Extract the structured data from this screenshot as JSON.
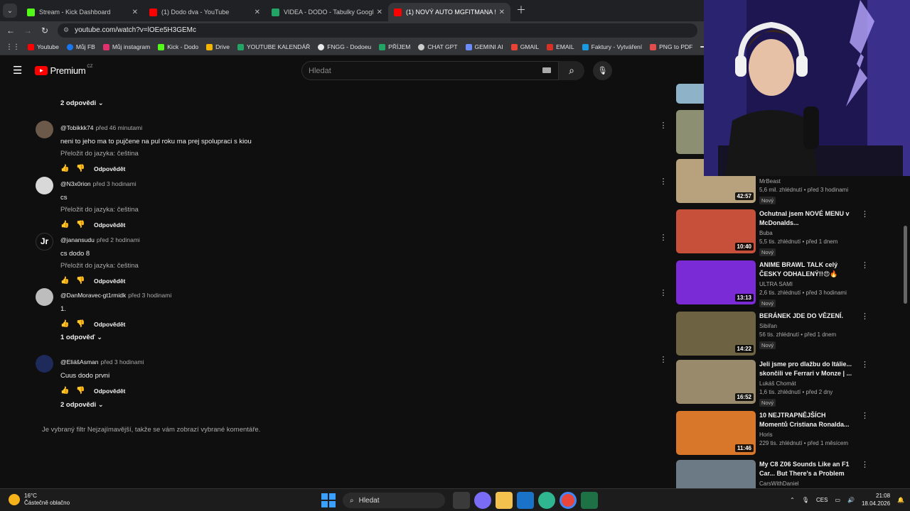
{
  "browser": {
    "tabs": [
      {
        "label": "Stream - Kick Dashboard",
        "color": "#53fc18"
      },
      {
        "label": "(1) Dodo dva - YouTube",
        "color": "#ff0000"
      },
      {
        "label": "VIDEA - DODO - Tabulky Googl",
        "color": "#21a464"
      },
      {
        "label": "(1) NOVÝ AUTO MGFITMANA !!",
        "color": "#ff0000"
      }
    ],
    "url": "youtube.com/watch?v=lOEe5H3GEMc",
    "bookmarks": [
      {
        "label": "Youtube",
        "color": "#ff0000"
      },
      {
        "label": "Můj FB",
        "color": "#1877f2"
      },
      {
        "label": "Můj instagram",
        "color": "#e1306c"
      },
      {
        "label": "Kick - Dodo",
        "color": "#53fc18"
      },
      {
        "label": "Drive",
        "color": "#f4b400"
      },
      {
        "label": "YOUTUBE KALENDÁŘ",
        "color": "#21a464"
      },
      {
        "label": "FNGG - Dodoeu",
        "color": "#e8e8e8"
      },
      {
        "label": "PŘÍJEM",
        "color": "#21a464"
      },
      {
        "label": "CHAT GPT",
        "color": "#cccccc"
      },
      {
        "label": "GEMINI AI",
        "color": "#6b8cff"
      },
      {
        "label": "GMAIL",
        "color": "#ea4335"
      },
      {
        "label": "EMAIL",
        "color": "#d93025"
      },
      {
        "label": "Faktury - Vytváření",
        "color": "#1a9be0"
      },
      {
        "label": "PNG to PDF",
        "color": "#e34c4c"
      },
      {
        "label": "htt",
        "color": "#e34c4c"
      }
    ]
  },
  "youtube": {
    "logo": "Premium",
    "region": "CZ",
    "search_placeholder": "Hledat",
    "replies_labels": [
      "2 odpovědi",
      "1 odpověď",
      "2 odpovědi"
    ],
    "comments": [
      {
        "user": "@Tobikkk74",
        "time": "před 46 minutami",
        "text": "neni to jeho ma to pujčene na pul roku ma prej spolupraci s kiou",
        "translate": "Přeložit do jazyka: čeština",
        "reply": "Odpovědět"
      },
      {
        "user": "@N3x0rion",
        "time": "před 3 hodinami",
        "text": "cs",
        "translate": "Přeložit do jazyka: čeština",
        "reply": "Odpovědět"
      },
      {
        "user": "@janansudu",
        "time": "před 2 hodinami",
        "text": "cs dodo 8",
        "translate": "Přeložit do jazyka: čeština",
        "reply": "Odpovědět"
      },
      {
        "user": "@DanMoravec-gt1rmidk",
        "time": "před 3 hodinami",
        "text": "1.",
        "translate": "",
        "reply": "Odpovědět"
      },
      {
        "user": "@EliášAsman",
        "time": "před 3 hodinami",
        "text": "Cuus dodo prvni",
        "translate": "",
        "reply": "Odpovědět"
      }
    ],
    "filter_note": "Je vybraný filtr Nejzajímavější, takže se vám zobrazí vybrané komentáře.",
    "sidebar": [
      {
        "title": "",
        "channel": "MrBeast",
        "meta": "5,6 mil. zhlédnutí • před 3 hodinami",
        "badge": "Nový",
        "duration": "42:57",
        "thumb": "#b7a27d"
      },
      {
        "title": "Ochutnal jsem NOVÉ MENU v McDonalds...",
        "channel": "Buba",
        "meta": "5,5 tis. zhlédnutí • před 1 dnem",
        "badge": "Nový",
        "duration": "10:40",
        "thumb": "#c7503b"
      },
      {
        "title": "ANIME BRAWL TALK celý ČESKY ODHALENÝ!!😍🔥",
        "channel": "ULTRA SAMI",
        "meta": "2,6 tis. zhlédnutí • před 3 hodinami",
        "badge": "Nový",
        "duration": "13:13",
        "thumb": "#7a2bd6"
      },
      {
        "title": "BERÁNEK JDE DO VĚZENÍ.",
        "channel": "Sibiřan",
        "meta": "56 tis. zhlédnutí • před 1 dnem",
        "badge": "Nový",
        "duration": "14:22",
        "thumb": "#6d6242"
      },
      {
        "title": "Jeli jsme pro dlažbu do Itálie... skončili ve Ferrari v Monze | ...",
        "channel": "Lukáš Chomát",
        "meta": "1,6 tis. zhlédnutí • před 2 dny",
        "badge": "Nový",
        "duration": "16:52",
        "thumb": "#9a8a6c"
      },
      {
        "title": "10 NEJTRAPNĚJŠÍCH Momentů Cristiana Ronalda...",
        "channel": "Horis",
        "meta": "229 tis. zhlédnutí • před 1 měsícem",
        "badge": "",
        "duration": "11:46",
        "thumb": "#d8772a"
      },
      {
        "title": "My C8 Z06 Sounds Like an F1 Car... But There's a Problem",
        "channel": "CarsWithDaniel",
        "meta": "",
        "badge": "",
        "duration": "",
        "thumb": "#6b7a84"
      }
    ]
  },
  "taskbar": {
    "temp": "16°C",
    "weather": "Částečně oblačno",
    "search": "Hledat",
    "lang": "CES",
    "time": "21:08",
    "date": "18.04.2026"
  }
}
